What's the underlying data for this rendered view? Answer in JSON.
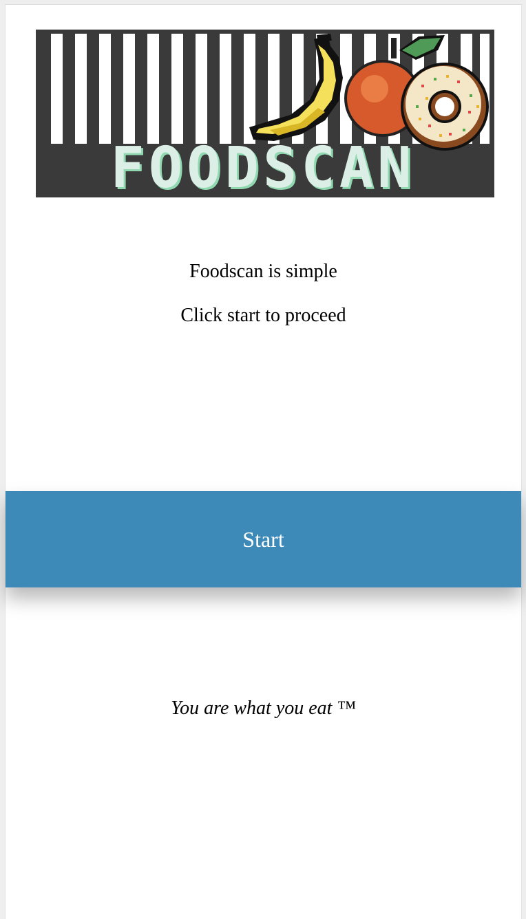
{
  "logo": {
    "text": "FOODSCAN",
    "colors": {
      "background": "#3a3a3a",
      "stripes": "#ffffff",
      "letters": "#dcefe6",
      "letter_shadow": "#8fd8b0",
      "banana": "#f4e05a",
      "apple": "#d65a2c",
      "donut": "#f4e7c8"
    }
  },
  "intro": {
    "line1": "Foodscan is simple",
    "line2": "Click start to proceed"
  },
  "start_button": {
    "label": "Start",
    "color": "#3d89b7"
  },
  "tagline": "You are what you eat ™"
}
